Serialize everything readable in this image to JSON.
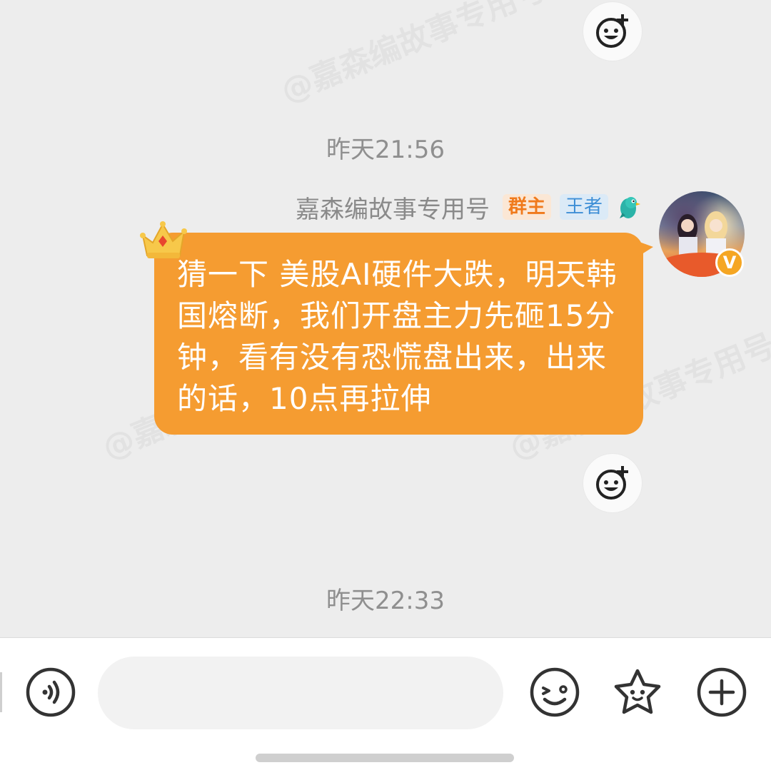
{
  "watermark": "@嘉森编故事专用号",
  "messages": {
    "timestamp_1": "昨天21:56",
    "sender": {
      "name": "嘉森编故事专用号",
      "role_tag": "群主",
      "level_tag": "王者",
      "verified_badge": "V"
    },
    "text": "猜一下 美股AI硬件大跌，明天韩国熔断，我们开盘主力先砸15分钟，看有没有恐慌盘出来，出来的话，10点再拉伸",
    "timestamp_2": "昨天22:33"
  },
  "input_bar": {
    "placeholder": "",
    "icons": [
      "voice-icon",
      "emoji-icon",
      "sticker-icon",
      "plus-icon"
    ]
  },
  "colors": {
    "background": "#ededed",
    "bubble": "#f59c31",
    "owner_tag_text": "#f07a1c",
    "level_tag_text": "#3f8fd6"
  }
}
